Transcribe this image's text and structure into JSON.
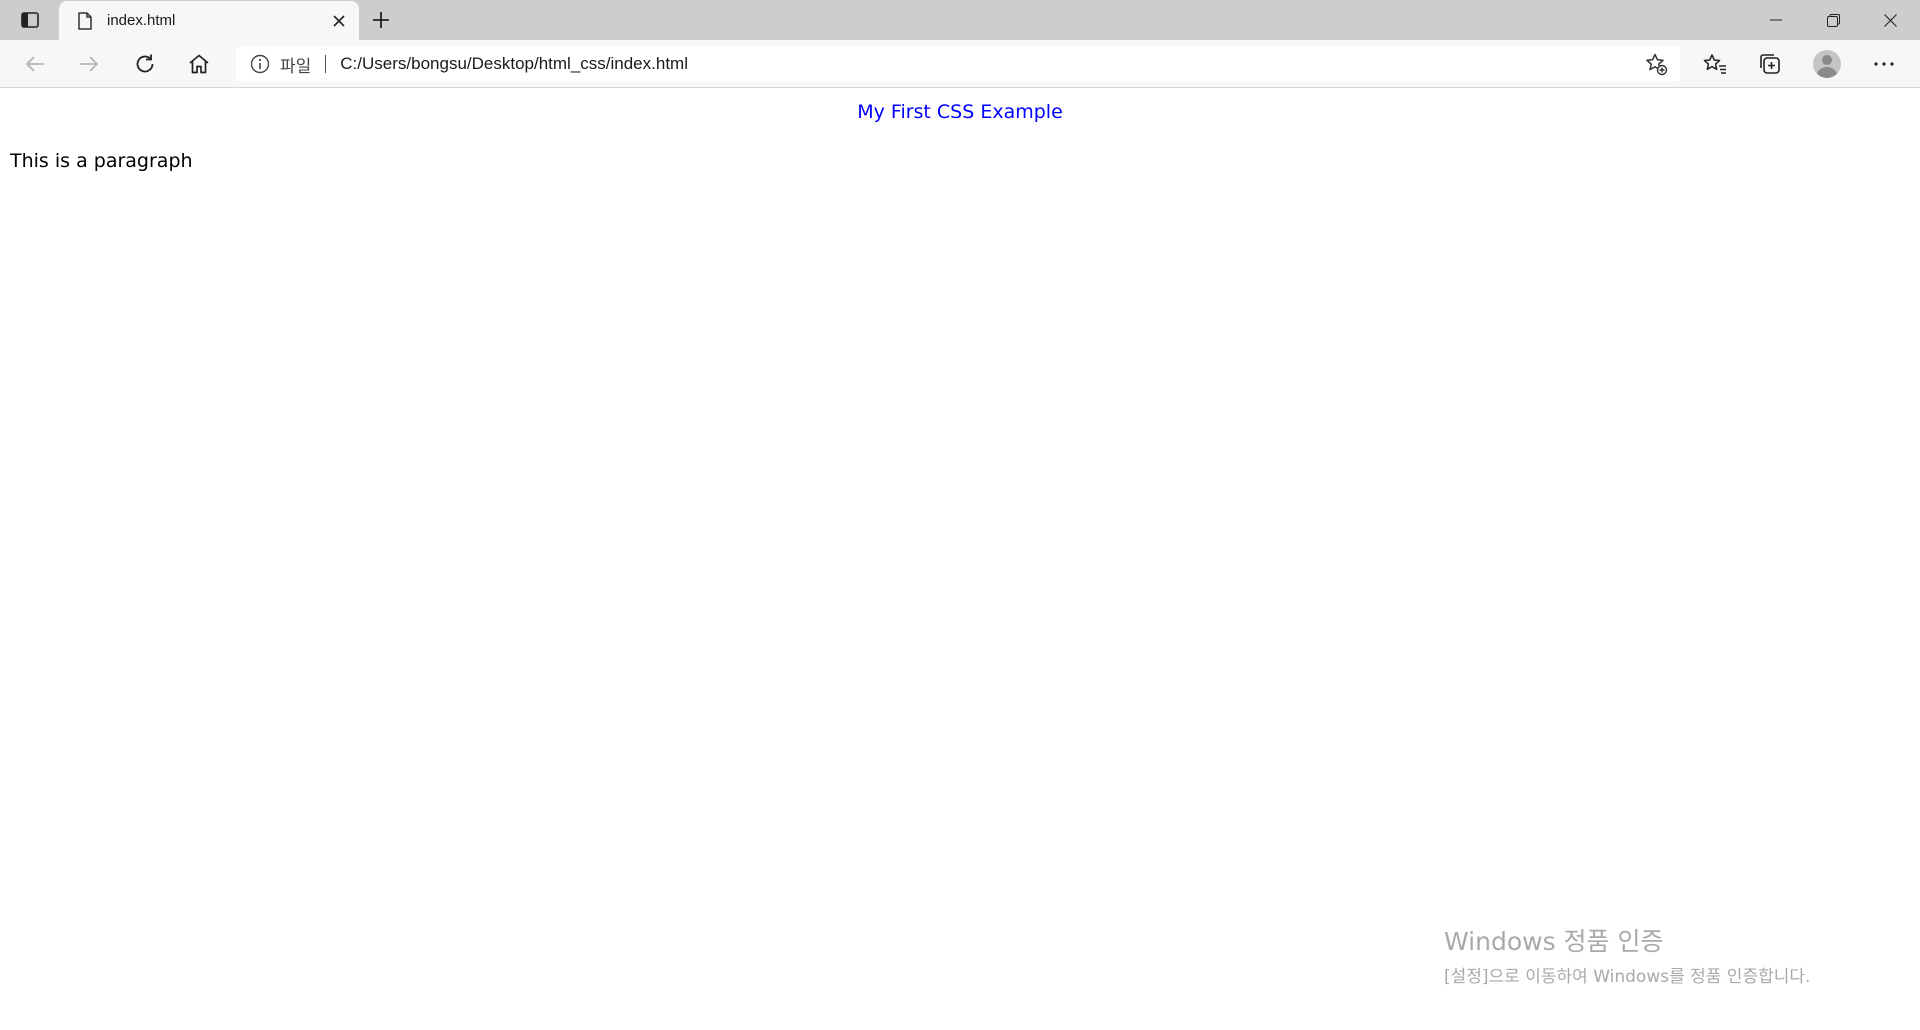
{
  "browser": {
    "tab": {
      "title": "index.html"
    },
    "address_bar": {
      "site_info_label": "파일",
      "url": "C:/Users/bongsu/Desktop/html_css/index.html"
    }
  },
  "page": {
    "heading": "My First CSS Example",
    "paragraph": "This is a paragraph"
  },
  "watermark": {
    "title": "Windows 정품 인증",
    "subtitle": "[설정]으로 이동하여 Windows를 정품 인증합니다."
  },
  "colors": {
    "heading_text": "#0000ff",
    "tabstrip_bg": "#cdcdcd",
    "toolbar_bg": "#f7f7f7"
  }
}
